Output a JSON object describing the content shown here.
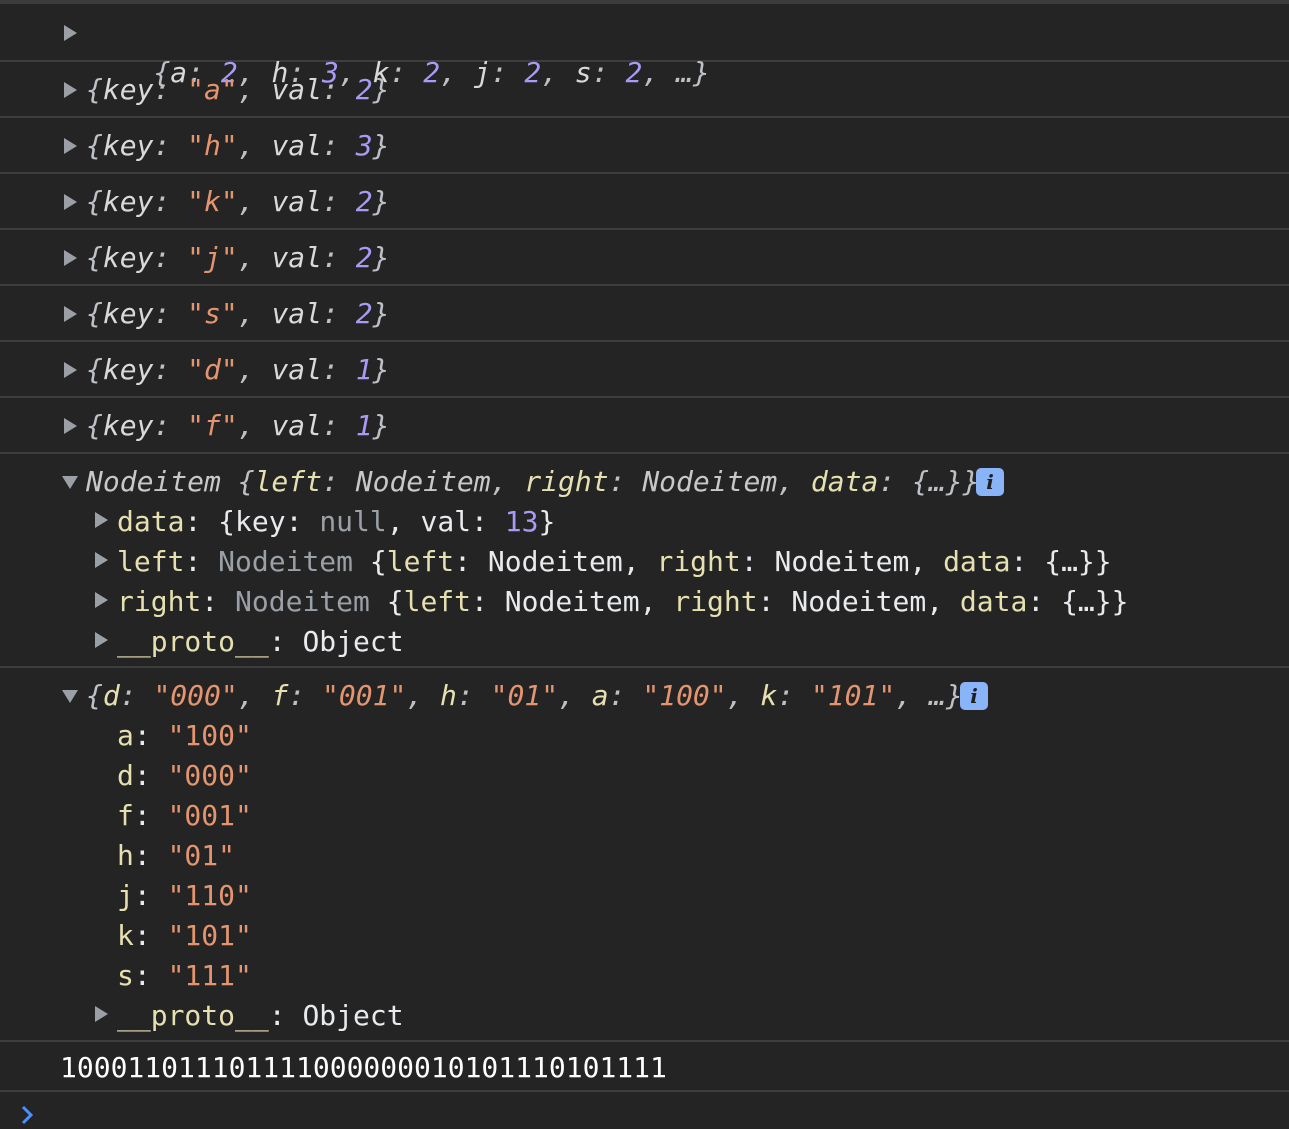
{
  "console": {
    "rows": [
      {
        "summary": [
          "{",
          "a",
          ": ",
          "2",
          ", ",
          "h",
          ": ",
          "3",
          ", ",
          "k",
          ": ",
          "2",
          ", ",
          "j",
          ": ",
          "2",
          ", ",
          "s",
          ": ",
          "2",
          ", …}"
        ]
      },
      {
        "key": "a",
        "val": "2"
      },
      {
        "key": "h",
        "val": "3"
      },
      {
        "key": "k",
        "val": "2"
      },
      {
        "key": "j",
        "val": "2"
      },
      {
        "key": "s",
        "val": "2"
      },
      {
        "key": "d",
        "val": "1"
      },
      {
        "key": "f",
        "val": "1"
      }
    ],
    "labels": {
      "key": "key",
      "val": "val"
    },
    "node": {
      "header_class": "Nodeitem",
      "header_left": "left",
      "header_right": "right",
      "header_data": "data",
      "header_left_type": "Nodeitem",
      "header_right_type": "Nodeitem",
      "ellipsis_obj": "{…}",
      "data_key": "data",
      "data_null": "null",
      "data_val": "13",
      "left_label": "left",
      "right_label": "right",
      "proto_label": "__proto__",
      "proto_value": "Object"
    },
    "codes": {
      "summary_pairs": [
        {
          "k": "d",
          "v": "\"000\""
        },
        {
          "k": "f",
          "v": "\"001\""
        },
        {
          "k": "h",
          "v": "\"01\""
        },
        {
          "k": "a",
          "v": "\"100\""
        },
        {
          "k": "k",
          "v": "\"101\""
        }
      ],
      "entries": [
        {
          "k": "a",
          "v": "\"100\""
        },
        {
          "k": "d",
          "v": "\"000\""
        },
        {
          "k": "f",
          "v": "\"001\""
        },
        {
          "k": "h",
          "v": "\"01\""
        },
        {
          "k": "j",
          "v": "\"110\""
        },
        {
          "k": "k",
          "v": "\"101\""
        },
        {
          "k": "s",
          "v": "\"111\""
        }
      ],
      "proto_label": "__proto__",
      "proto_value": "Object"
    },
    "output_text": "100011011101111000000010101110101111",
    "colors": {
      "background": "#242424",
      "string": "#e4956f",
      "number": "#a89bf5",
      "info_badge": "#8ab4f8"
    }
  }
}
